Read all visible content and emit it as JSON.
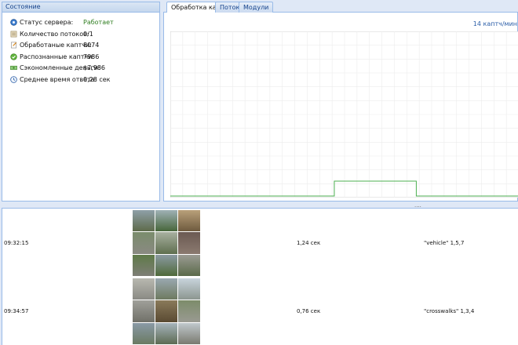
{
  "status": {
    "title": "Состояние",
    "rows": [
      {
        "label": "Статус сервера:",
        "value": "Работает",
        "icon": "server-status-icon"
      },
      {
        "label": "Количество потоков:",
        "value": "0/1",
        "icon": "threads-icon"
      },
      {
        "label": "Обработаные каптчи:",
        "value": "8074",
        "icon": "processed-icon"
      },
      {
        "label": "Распознанные каптчи:",
        "value": "7986",
        "icon": "recognized-check-icon"
      },
      {
        "label": "Сэкономленные деньги:",
        "value": "$7,986",
        "icon": "money-icon"
      },
      {
        "label": "Среднее время ответа:",
        "value": "0,28 сек",
        "icon": "clock-icon"
      }
    ]
  },
  "tabs": [
    {
      "label": "Обработка каптч",
      "active": true
    },
    {
      "label": "Потоки",
      "active": false
    },
    {
      "label": "Модули",
      "active": false
    }
  ],
  "chart": {
    "rate_label": "14 каптч/мин"
  },
  "chart_data": {
    "type": "line",
    "series": [
      {
        "values": [
          0,
          0,
          0,
          0,
          0,
          0,
          0,
          0,
          1,
          1,
          1,
          1,
          0,
          0,
          0,
          0,
          0,
          0
        ]
      }
    ],
    "grid": true
  },
  "splitter": "....",
  "log": [
    {
      "time": "09:32:15",
      "duration": "1,24 сек",
      "answer": "\"vehicle\" 1,5,7"
    },
    {
      "time": "09:34:57",
      "duration": "0,76 сек",
      "answer": "\"crosswalks\" 1,3,4"
    }
  ],
  "colors": {
    "accent": "#15428b",
    "border": "#99bbe8",
    "ok": "#2e7d1f",
    "chart_line": "#4caf50"
  }
}
